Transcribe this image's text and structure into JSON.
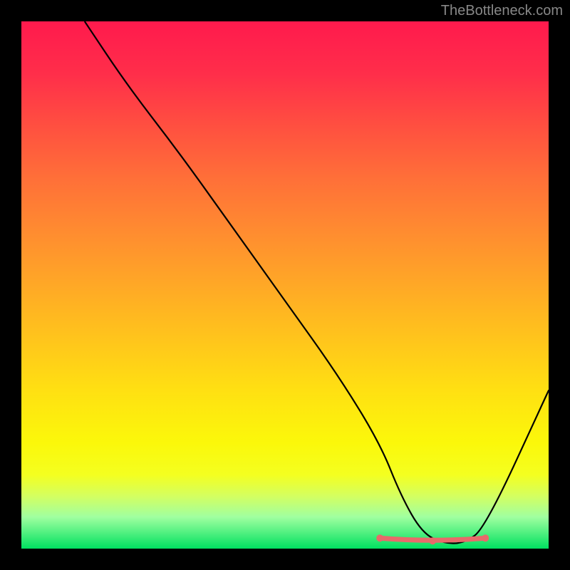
{
  "watermark": "TheBottleneck.com",
  "chart_data": {
    "type": "line",
    "title": "",
    "xlabel": "",
    "ylabel": "",
    "xlim": [
      0,
      100
    ],
    "ylim": [
      0,
      100
    ],
    "x": [
      12,
      20,
      30,
      40,
      50,
      60,
      68,
      72,
      76,
      80,
      84,
      88,
      100
    ],
    "values": [
      100,
      88,
      75,
      61,
      47,
      33,
      20,
      10,
      3,
      1,
      1,
      4,
      30
    ],
    "flat_region": {
      "x_start": 68,
      "x_end": 88,
      "approx_y": 2
    },
    "gradient": {
      "top_color": "#ff1a4d",
      "mid_color": "#ffc41c",
      "bottom_color": "#00e060"
    }
  }
}
